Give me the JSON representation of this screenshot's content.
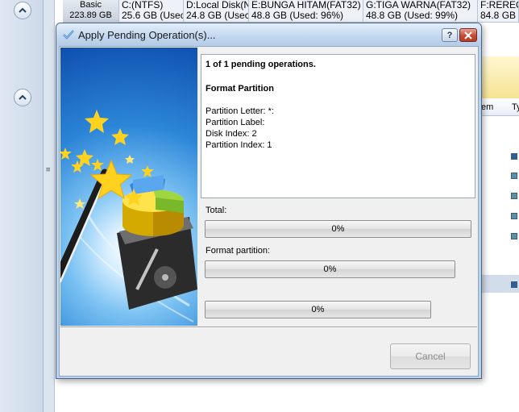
{
  "background": {
    "disks": [
      {
        "line1": "Basic",
        "line2": "223.89 GB"
      },
      {
        "line1": "C:(NTFS)",
        "line2": "25.6 GB (Usec"
      },
      {
        "line1": "D:Local Disk(N",
        "line2": "24.8 GB (Usec"
      },
      {
        "line1": "E:BUNGA HITAM(FAT32)",
        "line2": "48.8 GB (Used: 96%)"
      },
      {
        "line1": "G:TIGA WARNA(FAT32)",
        "line2": "48.8 GB (Used: 99%)"
      },
      {
        "line1": "F:REREO",
        "line2": "84.8 GB"
      }
    ],
    "right_header": {
      "col1": "em",
      "col2": "Ty"
    }
  },
  "dialog": {
    "title": "Apply Pending Operation(s)...",
    "help_glyph": "?",
    "info": {
      "count": "1 of 1 pending operations.",
      "operation": "Format Partition",
      "lines": [
        "Partition Letter: *:",
        "Partition Label:",
        "Disk Index: 2",
        "Partition Index: 1"
      ]
    },
    "progress": {
      "total": {
        "label": "Total:",
        "percent": 0,
        "text": "0%"
      },
      "format": {
        "label": "Format partition:",
        "percent": 0,
        "text": "0%"
      },
      "third": {
        "percent": 0,
        "text": "0%"
      }
    },
    "cancel_label": "Cancel"
  },
  "colors": {
    "titlebar": "#c2d7ee",
    "dialog_frame": "#b9d1ea",
    "art_blue": "#2c86d8",
    "progress_fill": "#2dbb2d"
  }
}
